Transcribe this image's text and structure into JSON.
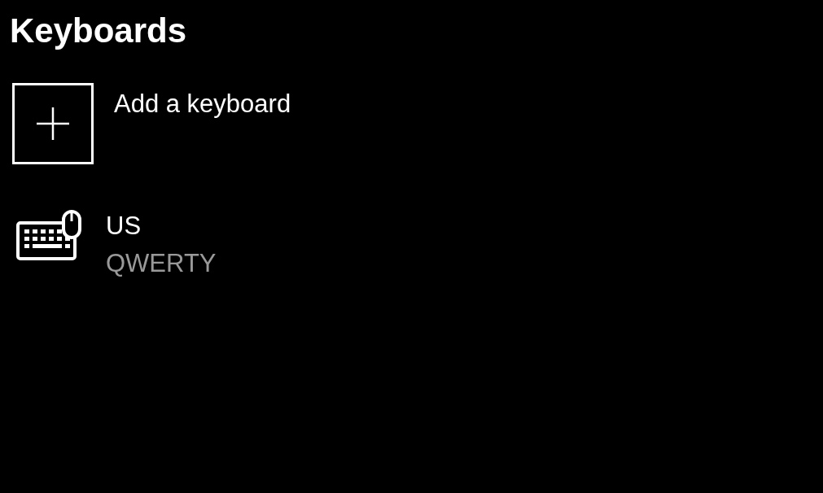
{
  "title": "Keyboards",
  "add_keyboard": {
    "label": "Add a keyboard"
  },
  "keyboards": [
    {
      "name": "US",
      "layout": "QWERTY"
    }
  ]
}
